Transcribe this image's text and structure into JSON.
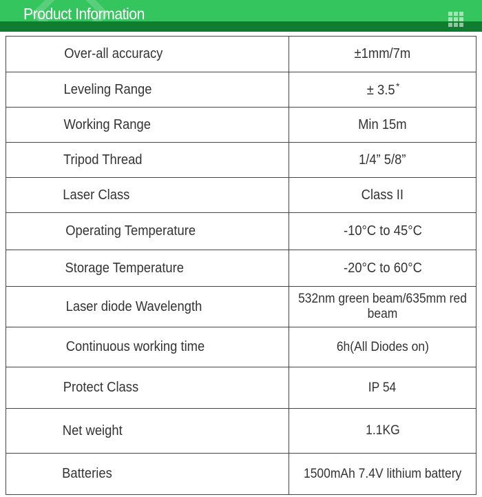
{
  "header": {
    "title": "Product Information",
    "icon": "grid-icon",
    "colors": {
      "bar": "#35c55e",
      "band": "#0f7d2f"
    }
  },
  "specs": [
    {
      "label": "Over-all accuracy",
      "value": "±1mm/7m"
    },
    {
      "label": "Leveling Range",
      "value": "± 3.5",
      "note": "*"
    },
    {
      "label": "Working Range",
      "value": "Min 15m"
    },
    {
      "label": "Tripod Thread",
      "value": "1/4” 5/8”"
    },
    {
      "label": "Laser Class",
      "value": "Class II"
    },
    {
      "label": "Operating Temperature",
      "value": "-10°C to 45°C"
    },
    {
      "label": "Storage Temperature",
      "value": "-20°C to 60°C"
    },
    {
      "label": "Laser diode Wavelength",
      "value": "532nm green beam/635mm red beam"
    },
    {
      "label": "Continuous working time",
      "value": "6h(All Diodes on)"
    },
    {
      "label": "Protect Class",
      "value": "IP 54"
    },
    {
      "label": "Net weight",
      "value": "1.1KG"
    },
    {
      "label": "Batteries",
      "value": "1500mAh 7.4V lithium battery"
    }
  ]
}
